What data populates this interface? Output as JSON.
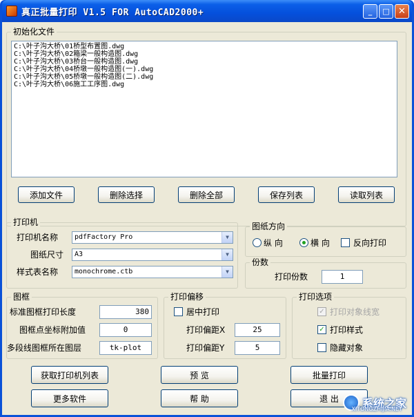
{
  "window": {
    "title": "真正批量打印 V1.5 FOR AutoCAD2000+",
    "minimize": "_",
    "maximize": "□",
    "close": "✕"
  },
  "init_files": {
    "title": "初始化文件",
    "files": [
      "C:\\叶子沟大桥\\01桥型布置图.dwg",
      "C:\\叶子沟大桥\\02箱梁一般构造图.dwg",
      "C:\\叶子沟大桥\\03桥台一般构造图.dwg",
      "C:\\叶子沟大桥\\04桥墩一般构造图(一).dwg",
      "C:\\叶子沟大桥\\05桥墩一般构造图(二).dwg",
      "C:\\叶子沟大桥\\06施工工序图.dwg"
    ],
    "buttons": {
      "add": "添加文件",
      "remove_selected": "删除选择",
      "remove_all": "删除全部",
      "save_list": "保存列表",
      "load_list": "读取列表"
    }
  },
  "printer": {
    "title": "打印机",
    "name_label": "打印机名称",
    "name_value": "pdfFactory Pro",
    "paper_label": "图纸尺寸",
    "paper_value": "A3",
    "style_label": "样式表名称",
    "style_value": "monochrome.ctb"
  },
  "orientation": {
    "title": "图纸方向",
    "portrait": "纵 向",
    "landscape": "横 向",
    "reverse": "反向打印",
    "selected": "landscape"
  },
  "copies": {
    "title": "份数",
    "label": "打印份数",
    "value": "1"
  },
  "frame": {
    "title": "图框",
    "length_label": "标准图框打印长度",
    "length_value": "380",
    "coord_label": "图框点坐标附加值",
    "coord_value": "0",
    "layer_label": "多段线图框所在图层",
    "layer_value": "tk-plot"
  },
  "offset": {
    "title": "打印偏移",
    "center_label": "居中打印",
    "x_label": "打印偏距X",
    "x_value": "25",
    "y_label": "打印偏距Y",
    "y_value": "5"
  },
  "options": {
    "title": "打印选项",
    "lineweight": "打印对象线宽",
    "plotstyle": "打印样式",
    "hide": "隐藏对象"
  },
  "bottom": {
    "get_printers": "获取打印机列表",
    "more_software": "更多软件",
    "preview": "预 览",
    "help": "帮 助",
    "batch_print": "批量打印",
    "exit": "退 出"
  },
  "watermark": {
    "text": "系统之家",
    "url": "XITONGZHIJIA.NET"
  },
  "colors": {
    "titlebar": "#0550dc",
    "client_bg": "#ece9d8",
    "check_green": "#21a121"
  }
}
